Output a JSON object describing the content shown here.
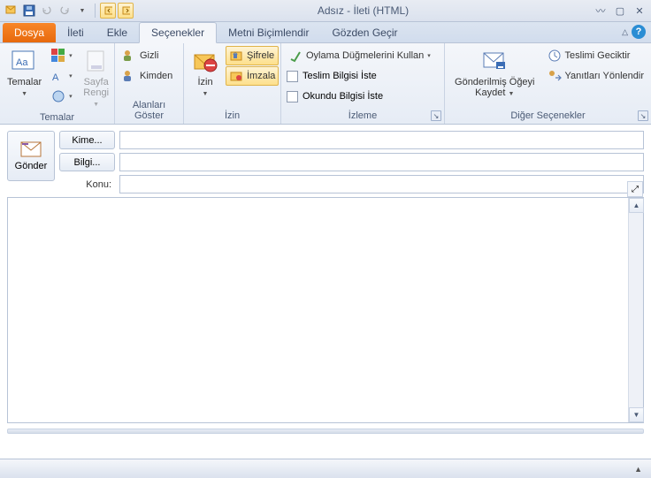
{
  "window": {
    "title": "Adsız  - İleti (HTML)"
  },
  "tabs": {
    "file": "Dosya",
    "items": [
      "İleti",
      "Ekle",
      "Seçenekler",
      "Metni Biçimlendir",
      "Gözden Geçir"
    ],
    "active": "Seçenekler"
  },
  "ribbon": {
    "themes": {
      "label": "Temalar",
      "btn_themes": "Temalar",
      "btn_pagecolor": "Sayfa Rengi"
    },
    "fields": {
      "label": "Alanları Göster",
      "bcc": "Gizli",
      "from": "Kimden"
    },
    "permission": {
      "label": "İzin",
      "btn_permission": "İzin",
      "encrypt": "Şifrele",
      "sign": "İmzala"
    },
    "tracking": {
      "label": "İzleme",
      "voting": "Oylama Düğmelerini Kullan",
      "delivery": "Teslim Bilgisi İste",
      "read": "Okundu Bilgisi İste"
    },
    "moreoptions": {
      "label": "Diğer Seçenekler",
      "save_sent": "Gönderilmiş Öğeyi Kaydet",
      "delay": "Teslimi Geciktir",
      "direct": "Yanıtları Yönlendir"
    }
  },
  "compose": {
    "send": "Gönder",
    "to": "Kime...",
    "cc": "Bilgi...",
    "subject_label": "Konu:",
    "to_val": "",
    "cc_val": "",
    "subject_val": "",
    "body_val": ""
  }
}
